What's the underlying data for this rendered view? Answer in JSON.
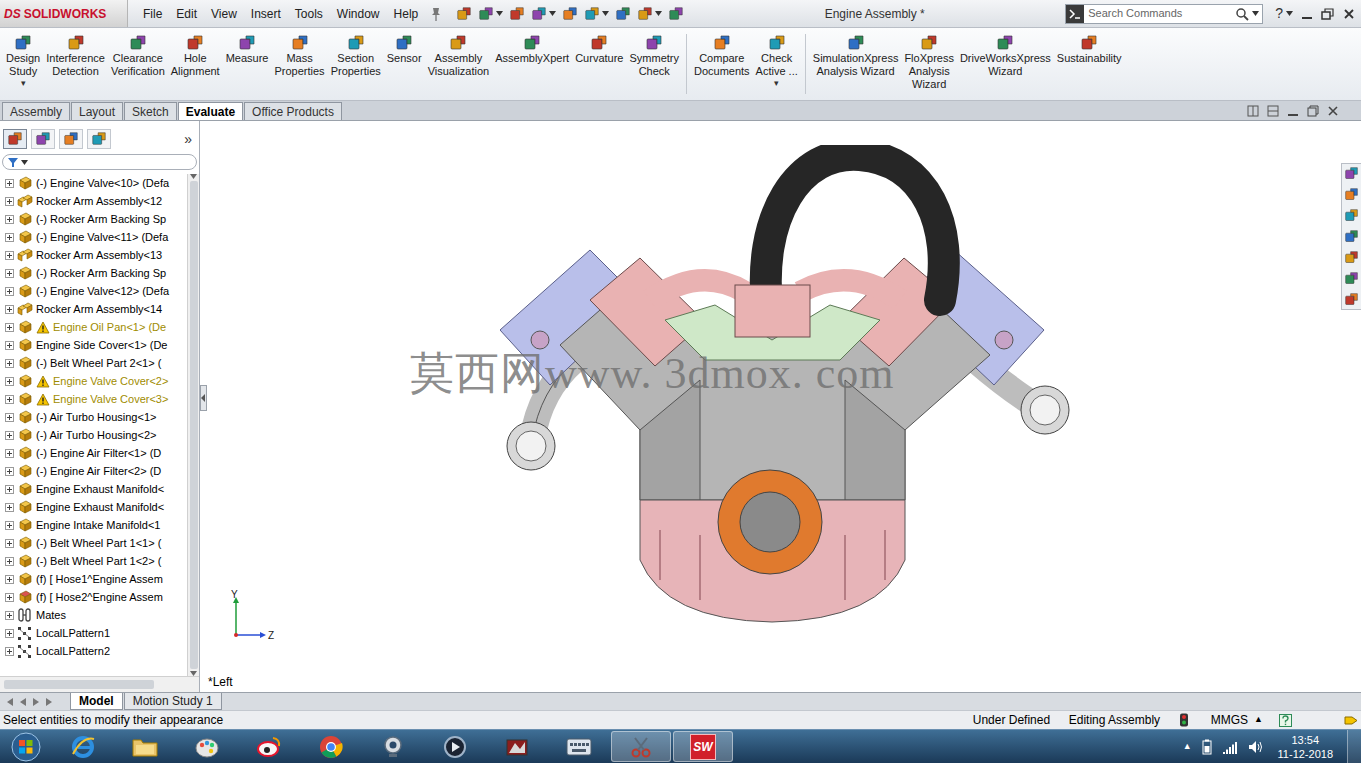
{
  "window": {
    "title": "Engine Assembly *"
  },
  "app_logo": {
    "brand": "DS",
    "name": "SOLIDWORKS"
  },
  "menu": [
    "File",
    "Edit",
    "View",
    "Insert",
    "Tools",
    "Window",
    "Help"
  ],
  "search": {
    "placeholder": "Search Commands"
  },
  "help_glyph": "?",
  "ribbon": [
    [
      {
        "lines": [
          "Design",
          "Study"
        ],
        "dropdown": "▾"
      },
      {
        "lines": [
          "Interference",
          "Detection"
        ]
      },
      {
        "lines": [
          "Clearance",
          "Verification"
        ]
      },
      {
        "lines": [
          "Hole",
          "Alignment"
        ]
      },
      {
        "lines": [
          "Measure"
        ]
      },
      {
        "lines": [
          "Mass",
          "Properties"
        ]
      },
      {
        "lines": [
          "Section",
          "Properties"
        ]
      },
      {
        "lines": [
          "Sensor"
        ]
      },
      {
        "lines": [
          "Assembly",
          "Visualization"
        ]
      },
      {
        "lines": [
          "AssemblyXpert"
        ]
      },
      {
        "lines": [
          "Curvature"
        ]
      },
      {
        "lines": [
          "Symmetry",
          "Check"
        ]
      }
    ],
    [
      {
        "lines": [
          "Compare",
          "Documents"
        ]
      },
      {
        "lines": [
          "Check",
          "Active ..."
        ],
        "dropdown": "▾"
      }
    ],
    [
      {
        "lines": [
          "SimulationXpress",
          "Analysis Wizard"
        ]
      },
      {
        "lines": [
          "FloXpress",
          "Analysis",
          "Wizard"
        ]
      },
      {
        "lines": [
          "DriveWorksXpress",
          "Wizard"
        ]
      },
      {
        "lines": [
          "Sustainability"
        ]
      }
    ]
  ],
  "tabs": [
    {
      "label": "Assembly",
      "selected": false
    },
    {
      "label": "Layout",
      "selected": false
    },
    {
      "label": "Sketch",
      "selected": false
    },
    {
      "label": "Evaluate",
      "selected": true
    },
    {
      "label": "Office Products",
      "selected": false
    }
  ],
  "panel_more": "»",
  "tree": [
    {
      "label": "(-) Engine Valve<10> (Defa",
      "kind": "part",
      "warning": false
    },
    {
      "label": "Rocker Arm Assembly<12",
      "kind": "assembly",
      "warning": false
    },
    {
      "label": "(-) Rocker Arm Backing Sp",
      "kind": "part",
      "warning": false
    },
    {
      "label": "(-) Engine Valve<11> (Defa",
      "kind": "part",
      "warning": false
    },
    {
      "label": "Rocker Arm Assembly<13",
      "kind": "assembly",
      "warning": false
    },
    {
      "label": "(-) Rocker Arm Backing Sp",
      "kind": "part",
      "warning": false
    },
    {
      "label": "(-) Engine Valve<12> (Defa",
      "kind": "part",
      "warning": false
    },
    {
      "label": "Rocker Arm Assembly<14",
      "kind": "assembly",
      "warning": false
    },
    {
      "label": "Engine Oil Pan<1> (De",
      "kind": "part",
      "warning": true
    },
    {
      "label": "Engine Side Cover<1> (De",
      "kind": "part",
      "warning": false
    },
    {
      "label": "(-) Belt Wheel Part  2<1> (",
      "kind": "part",
      "warning": false
    },
    {
      "label": "Engine Valve Cover<2>",
      "kind": "part",
      "warning": true
    },
    {
      "label": "Engine Valve Cover<3>",
      "kind": "part",
      "warning": true
    },
    {
      "label": "(-) Air Turbo Housing<1>",
      "kind": "part",
      "warning": false
    },
    {
      "label": "(-) Air Turbo Housing<2>",
      "kind": "part",
      "warning": false
    },
    {
      "label": "(-) Engine Air Filter<1> (D",
      "kind": "part",
      "warning": false
    },
    {
      "label": "(-) Engine Air Filter<2> (D",
      "kind": "part",
      "warning": false
    },
    {
      "label": "Engine Exhaust Manifold<",
      "kind": "part",
      "warning": false
    },
    {
      "label": "Engine Exhaust Manifold<",
      "kind": "part",
      "warning": false
    },
    {
      "label": "Engine Intake Manifold<1",
      "kind": "part",
      "warning": false
    },
    {
      "label": "(-) Belt Wheel Part  1<1> (",
      "kind": "part",
      "warning": false
    },
    {
      "label": "(-) Belt Wheel Part  1<2> (",
      "kind": "part",
      "warning": false
    },
    {
      "label": "(f) [ Hose1^Engine Assem",
      "kind": "part",
      "warning": false
    },
    {
      "label": "(f) [ Hose2^Engine Assem",
      "kind": "virtual",
      "warning": false
    },
    {
      "label": "Mates",
      "kind": "mates",
      "warning": false
    },
    {
      "label": "LocalLPattern1",
      "kind": "pattern",
      "warning": false
    },
    {
      "label": "LocalLPattern2",
      "kind": "pattern",
      "warning": false
    }
  ],
  "viewport": {
    "view_label": "*Left",
    "triad": {
      "y": "Y",
      "z": "Z"
    },
    "watermark": "莫西网www. 3dmox. com"
  },
  "bottom_tabs": [
    {
      "label": "Model",
      "selected": true
    },
    {
      "label": "Motion Study 1",
      "selected": false
    }
  ],
  "status_bar": {
    "message": "Select entities to modify their appearance",
    "state": "Under Defined",
    "mode": "Editing Assembly",
    "units": "MMGS",
    "units_arrow": "▲"
  },
  "taskbar": {
    "apps": [
      {
        "kind": "ie",
        "active": false
      },
      {
        "kind": "folder",
        "active": false
      },
      {
        "kind": "paint",
        "active": false
      },
      {
        "kind": "weibo",
        "active": false
      },
      {
        "kind": "chrome",
        "active": false
      },
      {
        "kind": "webcam",
        "active": false
      },
      {
        "kind": "media",
        "active": false
      },
      {
        "kind": "game",
        "active": false
      },
      {
        "kind": "keyboard",
        "active": false
      },
      {
        "kind": "snip",
        "active": true
      },
      {
        "kind": "solidworks",
        "active": true,
        "label": "SW"
      }
    ],
    "tray_arrow": "▲",
    "time": "13:54",
    "date": "11-12-2018"
  }
}
